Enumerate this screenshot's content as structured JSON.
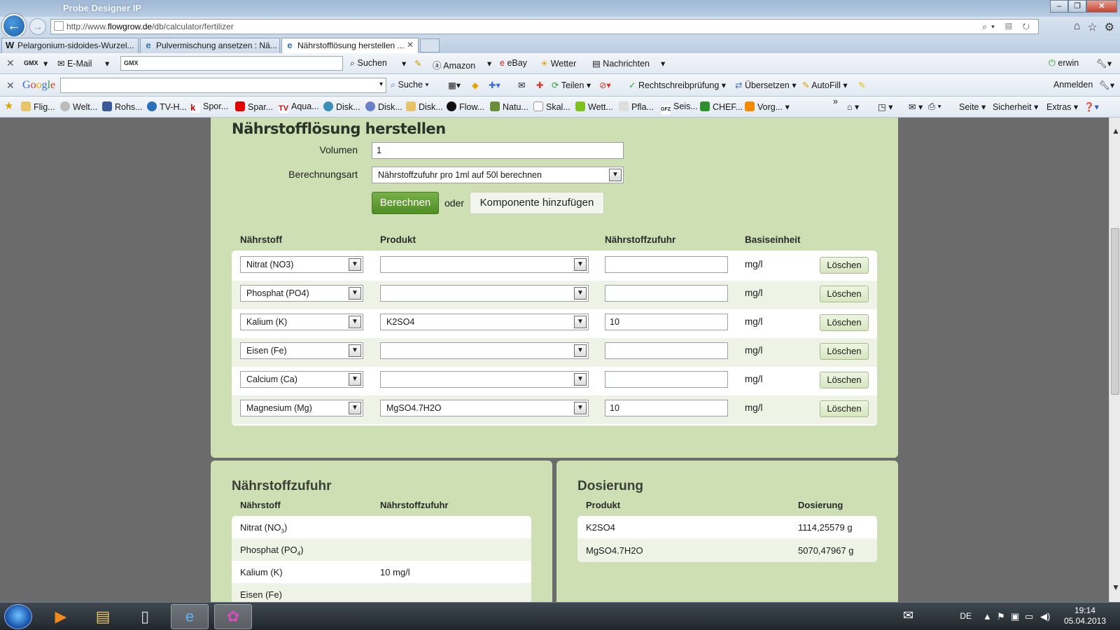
{
  "browser": {
    "window_title": "Probe Designer IP",
    "url_prefix": "http://www.",
    "url_domain": "flowgrow.de",
    "url_path": "/db/calculator/fertilizer",
    "tabs": [
      {
        "label": "Pelargonium-sidoides-Wurzel...",
        "icon": "W"
      },
      {
        "label": "Pulvermischung ansetzen : Nä...",
        "icon": "e"
      },
      {
        "label": "Nährstofflösung herstellen ...",
        "icon": "e",
        "active": true
      }
    ],
    "toolbar1": {
      "gmx": "GMX",
      "email": "E-Mail",
      "search_field": "GMX",
      "suchen": "Suchen",
      "amazon": "Amazon",
      "ebay": "eBay",
      "wetter": "Wetter",
      "nachrichten": "Nachrichten",
      "user": "erwin"
    },
    "toolbar2": {
      "google": [
        "G",
        "o",
        "o",
        "g",
        "l",
        "e"
      ],
      "suche": "Suche",
      "teilen": "Teilen",
      "rechtschreib": "Rechtschreibprüfung",
      "uebersetzen": "Übersetzen",
      "autofill": "AutoFill",
      "anmelden": "Anmelden"
    },
    "favorites": [
      "Flig...",
      "Welt...",
      "Rohs...",
      "TV-H...",
      "Spor...",
      "Spar...",
      "Aqua...",
      "Disk...",
      "Disk...",
      "Disk...",
      "Flow...",
      "Natu...",
      "Skal...",
      "Wett...",
      "Pfla...",
      "Seis...",
      "CHEF...",
      "Vorg..."
    ],
    "cmdbar": {
      "seite": "Seite",
      "sicherheit": "Sicherheit",
      "extras": "Extras"
    }
  },
  "page": {
    "title": "Nährstofflösung herstellen",
    "volumen_label": "Volumen",
    "volumen_value": "1",
    "berechnungsart_label": "Berechnungsart",
    "berechnungsart_value": "Nährstoffzufuhr pro 1ml auf 50l berechnen",
    "berechnen": "Berechnen",
    "oder": "oder",
    "komponente": "Komponente hinzufügen",
    "headers": {
      "naehrstoff": "Nährstoff",
      "produkt": "Produkt",
      "zufuhr": "Nährstoffzufuhr",
      "basis": "Basiseinheit"
    },
    "rows": [
      {
        "naehrstoff": "Nitrat (NO3)",
        "produkt": "",
        "zufuhr": "",
        "einheit": "mg/l",
        "delete": "Löschen"
      },
      {
        "naehrstoff": "Phosphat (PO4)",
        "produkt": "",
        "zufuhr": "",
        "einheit": "mg/l",
        "delete": "Löschen"
      },
      {
        "naehrstoff": "Kalium (K)",
        "produkt": "K2SO4",
        "zufuhr": "10",
        "einheit": "mg/l",
        "delete": "Löschen"
      },
      {
        "naehrstoff": "Eisen (Fe)",
        "produkt": "",
        "zufuhr": "",
        "einheit": "mg/l",
        "delete": "Löschen"
      },
      {
        "naehrstoff": "Calcium (Ca)",
        "produkt": "",
        "zufuhr": "",
        "einheit": "mg/l",
        "delete": "Löschen"
      },
      {
        "naehrstoff": "Magnesium (Mg)",
        "produkt": "MgSO4.7H2O",
        "zufuhr": "10",
        "einheit": "mg/l",
        "delete": "Löschen"
      }
    ],
    "zufuhr_panel": {
      "title": "Nährstoffzufuhr",
      "col1": "Nährstoff",
      "col2": "Nährstoffzufuhr",
      "rows": [
        {
          "name": "Nitrat (NO",
          "sub": "3",
          "close": ")",
          "value": ""
        },
        {
          "name": "Phosphat (PO",
          "sub": "4",
          "close": ")",
          "value": ""
        },
        {
          "name": "Kalium (K)",
          "sub": "",
          "close": "",
          "value": "10 mg/l"
        },
        {
          "name": "Eisen (Fe)",
          "sub": "",
          "close": "",
          "value": ""
        }
      ]
    },
    "dosierung_panel": {
      "title": "Dosierung",
      "col1": "Produkt",
      "col2": "Dosierung",
      "rows": [
        {
          "produkt": "K2SO4",
          "dosierung": "1114,25579 g"
        },
        {
          "produkt": "MgSO4.7H2O",
          "dosierung": "5070,47967 g"
        }
      ]
    }
  },
  "taskbar": {
    "lang": "DE",
    "time": "19:14",
    "date": "05.04.2013"
  }
}
